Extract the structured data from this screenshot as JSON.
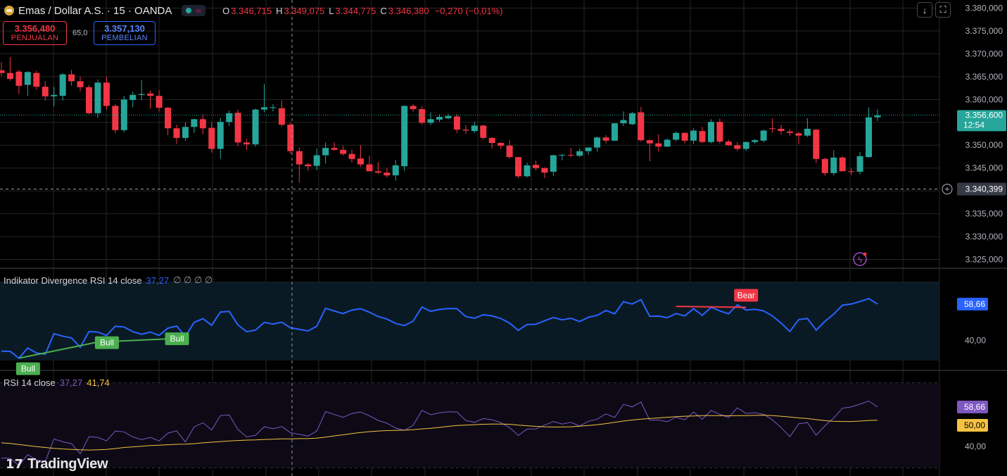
{
  "header": {
    "symbol": "Emas / Dollar A.S. · 15 · OANDA",
    "ohlc": [
      {
        "k": "O",
        "v": "3.346,715"
      },
      {
        "k": "H",
        "v": "3.349,075"
      },
      {
        "k": "L",
        "v": "3.344,775"
      },
      {
        "k": "C",
        "v": "3.346,380"
      }
    ],
    "change": "−0,270 (−0,01%)",
    "sell": {
      "price": "3.356,480",
      "label": "PENJUALAN"
    },
    "buy": {
      "price": "3.357,130",
      "label": "PEMBELIAN"
    },
    "spread": "65,0",
    "btn_down_icon": "arrow-down-icon",
    "btn_fullscreen_icon": "fullscreen-icon"
  },
  "rsi_div_label": {
    "name": "Indikator Divergence RSI 14 close",
    "value": "37,27",
    "extras": "∅ ∅ ∅ ∅"
  },
  "rsi_label": {
    "name": "RSI 14 close",
    "value1": "37,27",
    "value2": "41,74"
  },
  "logo": {
    "text": "TradingView"
  },
  "colors": {
    "up": "#26a69a",
    "down": "#f23645",
    "rsi": "#2962ff",
    "rsi_lower": "#7e57c2",
    "ma": "#f5c242",
    "bull": "#4caf50",
    "bear": "#f23645"
  },
  "chart_data": [
    {
      "type": "candlestick",
      "title": "Emas / Dollar A.S. · 15 · OANDA",
      "ylim": [
        3322000,
        3381000
      ],
      "y_ticks": [
        3380000,
        3375000,
        3370000,
        3365000,
        3360000,
        3355000,
        3350000,
        3345000,
        3340000,
        3335000,
        3330000,
        3325000
      ],
      "y_tick_labels": [
        "3.380,000",
        "3.375,000",
        "3.370,000",
        "3.365,000",
        "3.360,000",
        "3.355,000",
        "3.350,000",
        "3.345,000",
        "3.340,000",
        "3.335,000",
        "3.330,000",
        "3.325,000"
      ],
      "last_price": {
        "value": 3356600,
        "label": "3.356,600",
        "countdown": "12:54"
      },
      "crosshair_price": {
        "value": 3340399,
        "label": "3.340,399"
      },
      "candles": [
        [
          3366400,
          3368200,
          3365200,
          3365800
        ],
        [
          3365800,
          3369300,
          3364100,
          3364500
        ],
        [
          3366100,
          3366500,
          3361200,
          3363000
        ],
        [
          3363200,
          3366200,
          3360800,
          3366000
        ],
        [
          3365800,
          3366300,
          3362200,
          3362800
        ],
        [
          3362800,
          3364000,
          3359800,
          3360700
        ],
        [
          3360700,
          3362800,
          3358500,
          3361000
        ],
        [
          3360800,
          3365800,
          3359800,
          3365500
        ],
        [
          3365500,
          3366500,
          3363000,
          3364000
        ],
        [
          3364000,
          3365000,
          3361800,
          3362700
        ],
        [
          3362700,
          3363200,
          3356800,
          3357000
        ],
        [
          3357000,
          3364400,
          3356000,
          3363700
        ],
        [
          3363700,
          3365000,
          3357800,
          3358600
        ],
        [
          3358600,
          3359000,
          3352600,
          3353300
        ],
        [
          3353300,
          3360800,
          3352800,
          3360000
        ],
        [
          3359900,
          3361700,
          3358300,
          3361000
        ],
        [
          3361000,
          3364200,
          3359800,
          3361200
        ],
        [
          3361300,
          3362000,
          3358000,
          3360800
        ],
        [
          3360800,
          3362100,
          3357400,
          3358200
        ],
        [
          3358200,
          3358400,
          3352200,
          3353700
        ],
        [
          3353700,
          3354500,
          3350300,
          3351600
        ],
        [
          3351600,
          3355000,
          3351000,
          3354000
        ],
        [
          3354000,
          3355800,
          3352700,
          3355700
        ],
        [
          3355700,
          3356800,
          3352400,
          3353700
        ],
        [
          3353800,
          3355000,
          3348400,
          3349200
        ],
        [
          3349200,
          3356000,
          3347000,
          3355100
        ],
        [
          3355100,
          3357600,
          3354200,
          3357000
        ],
        [
          3357100,
          3357800,
          3349800,
          3350600
        ],
        [
          3350600,
          3351400,
          3349000,
          3350200
        ],
        [
          3350200,
          3358000,
          3349700,
          3357800
        ],
        [
          3357800,
          3363400,
          3357200,
          3358300
        ],
        [
          3358200,
          3359000,
          3357400,
          3358300
        ],
        [
          3358100,
          3359800,
          3354100,
          3354500
        ],
        [
          3354500,
          3355000,
          3348100,
          3348700
        ],
        [
          3348700,
          3349500,
          3341800,
          3345800
        ],
        [
          3345800,
          3346100,
          3344400,
          3345400
        ],
        [
          3345500,
          3349300,
          3344500,
          3347800
        ],
        [
          3347800,
          3350600,
          3346000,
          3349400
        ],
        [
          3349400,
          3350600,
          3348800,
          3349000
        ],
        [
          3349000,
          3349800,
          3347700,
          3348100
        ],
        [
          3348100,
          3349000,
          3346200,
          3347000
        ],
        [
          3347100,
          3350000,
          3345300,
          3345800
        ],
        [
          3345800,
          3347700,
          3344400,
          3344300
        ],
        [
          3344300,
          3346300,
          3343700,
          3344000
        ],
        [
          3344000,
          3345000,
          3342900,
          3343400
        ],
        [
          3343400,
          3346800,
          3342200,
          3345600
        ],
        [
          3345400,
          3358700,
          3344400,
          3358600
        ],
        [
          3358600,
          3359000,
          3357300,
          3357900
        ],
        [
          3357900,
          3358500,
          3354500,
          3354900
        ],
        [
          3354900,
          3357200,
          3354400,
          3355700
        ],
        [
          3355600,
          3356800,
          3355100,
          3356200
        ],
        [
          3355900,
          3356900,
          3355700,
          3356400
        ],
        [
          3356300,
          3356800,
          3352700,
          3353400
        ],
        [
          3353400,
          3354400,
          3352500,
          3353200
        ],
        [
          3353100,
          3355100,
          3352600,
          3354300
        ],
        [
          3354300,
          3354500,
          3351200,
          3351600
        ],
        [
          3351600,
          3351700,
          3349300,
          3350500
        ],
        [
          3350500,
          3350700,
          3349200,
          3349900
        ],
        [
          3349900,
          3351100,
          3347100,
          3347400
        ],
        [
          3347400,
          3347500,
          3342800,
          3343200
        ],
        [
          3343200,
          3346200,
          3343000,
          3345600
        ],
        [
          3345700,
          3346600,
          3344500,
          3345000
        ],
        [
          3345000,
          3345200,
          3342800,
          3344000
        ],
        [
          3344200,
          3347900,
          3343300,
          3347800
        ],
        [
          3347800,
          3348100,
          3346700,
          3347900
        ],
        [
          3347900,
          3349400,
          3347400,
          3347800
        ],
        [
          3347700,
          3349300,
          3347400,
          3348700
        ],
        [
          3348700,
          3349400,
          3347900,
          3349500
        ],
        [
          3349500,
          3351900,
          3348600,
          3351700
        ],
        [
          3351700,
          3352200,
          3350400,
          3351000
        ],
        [
          3351000,
          3354800,
          3350900,
          3354800
        ],
        [
          3354800,
          3357400,
          3354200,
          3355500
        ],
        [
          3354600,
          3357300,
          3354400,
          3357000
        ],
        [
          3357200,
          3358400,
          3350800,
          3351100
        ],
        [
          3351100,
          3351300,
          3346500,
          3350400
        ],
        [
          3350400,
          3352400,
          3348600,
          3349700
        ],
        [
          3349700,
          3351500,
          3349600,
          3351200
        ],
        [
          3351200,
          3353000,
          3350900,
          3352700
        ],
        [
          3352700,
          3352800,
          3350400,
          3351000
        ],
        [
          3351000,
          3353700,
          3350300,
          3353200
        ],
        [
          3353100,
          3354000,
          3350500,
          3350700
        ],
        [
          3350700,
          3355700,
          3350400,
          3355100
        ],
        [
          3355100,
          3355800,
          3350400,
          3350800
        ],
        [
          3350800,
          3351200,
          3349800,
          3350000
        ],
        [
          3350000,
          3350700,
          3348700,
          3349200
        ],
        [
          3349200,
          3350800,
          3348700,
          3350700
        ],
        [
          3350700,
          3351400,
          3350300,
          3351100
        ],
        [
          3351000,
          3353400,
          3350600,
          3353200
        ],
        [
          3353700,
          3355900,
          3352700,
          3353600
        ],
        [
          3353600,
          3354500,
          3352300,
          3353100
        ],
        [
          3353000,
          3353500,
          3352100,
          3352700
        ],
        [
          3352600,
          3352900,
          3350200,
          3352100
        ],
        [
          3352100,
          3355900,
          3351800,
          3353600
        ],
        [
          3353400,
          3353600,
          3346100,
          3347000
        ],
        [
          3347000,
          3347300,
          3343300,
          3343900
        ],
        [
          3343900,
          3348900,
          3343400,
          3347300
        ],
        [
          3347300,
          3347600,
          3344700,
          3344300
        ],
        [
          3344300,
          3345000,
          3343500,
          3344200
        ],
        [
          3344200,
          3348500,
          3343600,
          3347600
        ],
        [
          3347400,
          3358300,
          3347300,
          3356100
        ],
        [
          3356100,
          3357800,
          3355300,
          3356500
        ]
      ]
    },
    {
      "type": "line",
      "title": "Indikator Divergence RSI 14 close",
      "ylim": [
        25,
        72
      ],
      "y_ticks": [
        40,
        58.66
      ],
      "y_tick_labels": [
        "40,00",
        "58,66"
      ],
      "series": [
        {
          "name": "RSI 14",
          "values": [
            34.5,
            34.4,
            30.9,
            36.1,
            33.6,
            32.9,
            43.5,
            42.2,
            41.3,
            36.5,
            44.6,
            44.3,
            42.6,
            47.3,
            46.9,
            44.5,
            43.2,
            44.3,
            42.6,
            46.3,
            47.4,
            42.1,
            49.3,
            51.2,
            47.8,
            54.6,
            54.9,
            48.0,
            44.5,
            45.3,
            49.3,
            48.4,
            49.4,
            46.5,
            45.7,
            44.9,
            47.3,
            56.5,
            55.1,
            53.8,
            55.6,
            56.3,
            54.5,
            52.3,
            51.0,
            48.7,
            47.6,
            50.0,
            57.1,
            55.0,
            55.9,
            56.4,
            56.3,
            52.3,
            51.4,
            53.2,
            52.6,
            51.3,
            48.9,
            45.2,
            48.2,
            48.3,
            50.1,
            51.8,
            50.6,
            51.4,
            49.7,
            51.9,
            52.9,
            55.4,
            53.7,
            59.9,
            58.7,
            61.0,
            52.4,
            52.5,
            51.7,
            53.8,
            52.6,
            56.3,
            52.9,
            57.0,
            55.2,
            53.7,
            58.3,
            55.6,
            56.0,
            55.2,
            52.6,
            48.9,
            44.6,
            50.7,
            51.3,
            45.3,
            49.8,
            53.5,
            58.1,
            58.7,
            60.0,
            61.5,
            58.7
          ]
        },
        {
          "name": "Bull divergence",
          "color": "#4caf50",
          "points": [
            [
              2,
              30.9
            ],
            [
              11,
              39.2
            ],
            [
              19,
              40.8
            ]
          ]
        },
        {
          "name": "Bear divergence",
          "color": "#f23645",
          "points": [
            [
              77,
              57.5
            ],
            [
              85,
              57.0
            ]
          ]
        }
      ],
      "labels": [
        {
          "text": "Bull",
          "at": 2
        },
        {
          "text": "Bull",
          "at": 11
        },
        {
          "text": "Bull",
          "at": 19
        },
        {
          "text": "Bear",
          "at": 85
        }
      ],
      "last_value": "58,66"
    },
    {
      "type": "line",
      "title": "RSI 14 close",
      "ylim": [
        26,
        71
      ],
      "y_ticks": [
        40,
        50,
        58.66
      ],
      "y_tick_labels": [
        "40,00",
        "50,00",
        "58,66"
      ],
      "series": [
        {
          "name": "RSI",
          "values": [
            34.5,
            34.4,
            30.9,
            36.1,
            33.6,
            32.9,
            43.5,
            42.2,
            41.3,
            36.5,
            44.6,
            44.3,
            42.6,
            47.3,
            46.9,
            44.5,
            43.2,
            44.3,
            42.6,
            46.3,
            47.4,
            42.1,
            49.3,
            51.2,
            47.8,
            54.6,
            54.9,
            48.0,
            44.5,
            45.3,
            49.3,
            48.4,
            49.4,
            46.5,
            45.7,
            44.9,
            47.3,
            56.5,
            55.1,
            53.8,
            55.6,
            56.3,
            54.5,
            52.3,
            51.0,
            48.7,
            47.6,
            50.0,
            57.1,
            55.0,
            55.9,
            56.4,
            56.3,
            52.3,
            51.4,
            53.2,
            52.6,
            51.3,
            48.9,
            45.2,
            48.2,
            48.3,
            50.1,
            51.8,
            50.6,
            51.4,
            49.7,
            51.9,
            52.9,
            55.4,
            53.7,
            59.9,
            58.7,
            61.0,
            52.4,
            52.5,
            51.7,
            53.8,
            52.6,
            56.3,
            52.9,
            57.0,
            55.2,
            53.7,
            58.3,
            55.6,
            56.0,
            55.2,
            52.6,
            48.9,
            44.6,
            50.7,
            51.3,
            45.3,
            49.8,
            53.5,
            58.1,
            58.7,
            60.0,
            61.5,
            58.7
          ]
        },
        {
          "name": "MA",
          "values": [
            41.7,
            41.4,
            40.9,
            40.4,
            39.9,
            39.5,
            39.1,
            38.8,
            38.6,
            38.4,
            38.3,
            38.4,
            38.6,
            39.0,
            39.5,
            39.8,
            40.1,
            40.4,
            40.6,
            40.8,
            41.0,
            41.1,
            41.3,
            41.7,
            42.0,
            42.3,
            42.6,
            42.8,
            43.0,
            43.1,
            43.3,
            43.4,
            43.6,
            43.6,
            43.7,
            43.7,
            43.9,
            44.4,
            45.0,
            45.5,
            46.1,
            46.6,
            47.0,
            47.3,
            47.5,
            47.6,
            47.7,
            47.9,
            48.3,
            48.6,
            49.0,
            49.5,
            49.9,
            50.1,
            50.3,
            50.5,
            50.6,
            50.6,
            50.5,
            50.1,
            49.8,
            49.5,
            49.3,
            49.2,
            49.2,
            49.3,
            49.6,
            49.9,
            50.3,
            50.8,
            51.4,
            52.0,
            52.5,
            52.9,
            53.2,
            53.5,
            53.8,
            54.1,
            54.3,
            54.4,
            54.6,
            54.6,
            54.6,
            54.5,
            54.6,
            54.6,
            54.7,
            54.8,
            54.6,
            54.3,
            53.9,
            53.5,
            53.2,
            52.7,
            52.2,
            51.9,
            51.8,
            51.8,
            52.0,
            52.3,
            52.4
          ]
        }
      ],
      "last_values": [
        "58,66",
        "50,00"
      ]
    }
  ]
}
